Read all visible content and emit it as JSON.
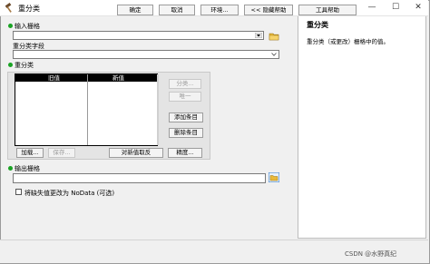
{
  "window": {
    "title": "重分类",
    "controls": {
      "minimize": "—",
      "maximize": "☐",
      "close": "✕"
    },
    "accent_color": "#1aa324"
  },
  "form": {
    "input_raster": {
      "label": "输入栅格",
      "value": ""
    },
    "reclass_field": {
      "label": "重分类字段",
      "value": ""
    },
    "reclassification": {
      "label": "重分类",
      "columns": [
        "旧值",
        "新值"
      ],
      "rows": [],
      "side_buttons": [
        {
          "label": "分类...",
          "enabled": false
        },
        {
          "label": "唯一",
          "enabled": false
        },
        {
          "label": "添加条目",
          "enabled": true
        },
        {
          "label": "删除条目",
          "enabled": true
        }
      ],
      "bottom_buttons": [
        {
          "label": "加载...",
          "enabled": true
        },
        {
          "label": "保存...",
          "enabled": false
        },
        {
          "label": "对新值取反",
          "enabled": true
        },
        {
          "label": "精度...",
          "enabled": true
        }
      ]
    },
    "output_raster": {
      "label": "输出栅格",
      "value": ""
    },
    "nodata_checkbox": {
      "label": "将缺失值更改为 NoData (可选)",
      "checked": false
    }
  },
  "footer": {
    "ok": "确定",
    "cancel": "取消",
    "environments": "环境...",
    "hide_help": "<< 隐藏帮助",
    "tool_help": "工具帮助"
  },
  "help_panel": {
    "title": "重分类",
    "description": "重分类（或更改）栅格中的值。"
  },
  "watermark": "CSDN @水野真纪"
}
